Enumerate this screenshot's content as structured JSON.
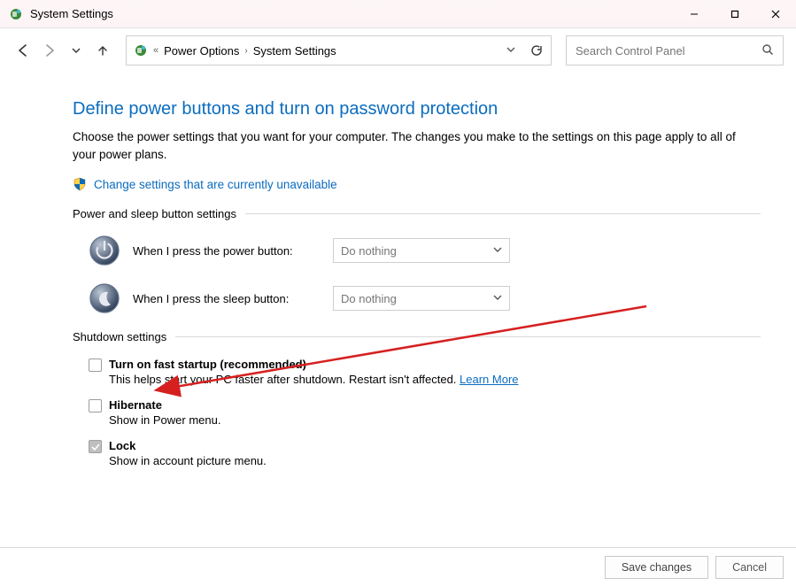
{
  "window": {
    "title": "System Settings"
  },
  "breadcrumb": {
    "level1": "Power Options",
    "level2": "System Settings"
  },
  "search": {
    "placeholder": "Search Control Panel"
  },
  "heading": "Define power buttons and turn on password protection",
  "description": "Choose the power settings that you want for your computer. The changes you make to the settings on this page apply to all of your power plans.",
  "change_link": "Change settings that are currently unavailable",
  "groups": {
    "power_sleep": "Power and sleep button settings",
    "shutdown": "Shutdown settings"
  },
  "power_button": {
    "label": "When I press the power button:",
    "value": "Do nothing"
  },
  "sleep_button": {
    "label": "When I press the sleep button:",
    "value": "Do nothing"
  },
  "shutdown_items": {
    "fast_startup": {
      "label": "Turn on fast startup (recommended)",
      "desc": "This helps start your PC faster after shutdown. Restart isn't affected. ",
      "learn_more": "Learn More",
      "checked": false
    },
    "hibernate": {
      "label": "Hibernate",
      "desc": "Show in Power menu.",
      "checked": false
    },
    "lock": {
      "label": "Lock",
      "desc": "Show in account picture menu.",
      "checked": true
    }
  },
  "buttons": {
    "save": "Save changes",
    "cancel": "Cancel"
  }
}
